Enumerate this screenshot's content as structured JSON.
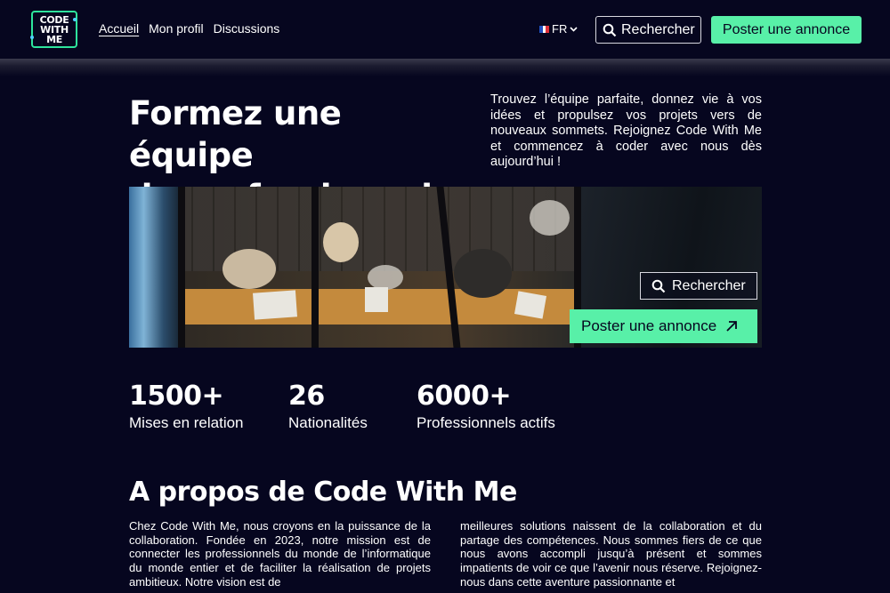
{
  "header": {
    "logo_lines": [
      "CODE",
      "WITH",
      "ME"
    ],
    "nav": [
      {
        "label": "Accueil",
        "active": true
      },
      {
        "label": "Mon profil",
        "active": false
      },
      {
        "label": "Discussions",
        "active": false
      }
    ],
    "language": "FR",
    "search_label": "Rechercher",
    "post_label": "Poster une annonce"
  },
  "hero": {
    "title_line1": "Formez une équipe",
    "title_line2": "de professionnels",
    "text": "Trouvez l’équipe parfaite, donnez vie à vos idées et propulsez vos projets vers de nouveaux sommets. Rejoignez Code With Me et commencez à coder avec nous dès aujourd’hui !",
    "search_label": "Rechercher",
    "post_label": "Poster une annonce"
  },
  "stats": [
    {
      "value": "1500+",
      "label": "Mises en relation"
    },
    {
      "value": "26",
      "label": "Nationalités"
    },
    {
      "value": "6000+",
      "label": "Professionnels actifs"
    }
  ],
  "about": {
    "title": "A propos de Code With Me",
    "col1": "Chez Code With Me, nous croyons en la puissance de la collaboration. Fondée en 2023, notre mission est de connecter les professionnels du monde de l’informatique du monde entier et de faciliter la réalisation de projets ambitieux. Notre vision est de",
    "col2": "meilleures solutions naissent de la collaboration et du partage des compétences. Nous sommes fiers de ce que nous avons accompli jusqu’à présent et sommes impatients de voir ce que l’avenir nous réserve. Rejoignez-nous dans cette aventure passionnante et"
  },
  "colors": {
    "background": "#06061f",
    "accent": "#58f0a8"
  },
  "icons": {
    "search": "search-icon",
    "arrow": "arrow-up-right-icon",
    "chevron": "chevron-down-icon",
    "flag": "france-flag-icon"
  }
}
